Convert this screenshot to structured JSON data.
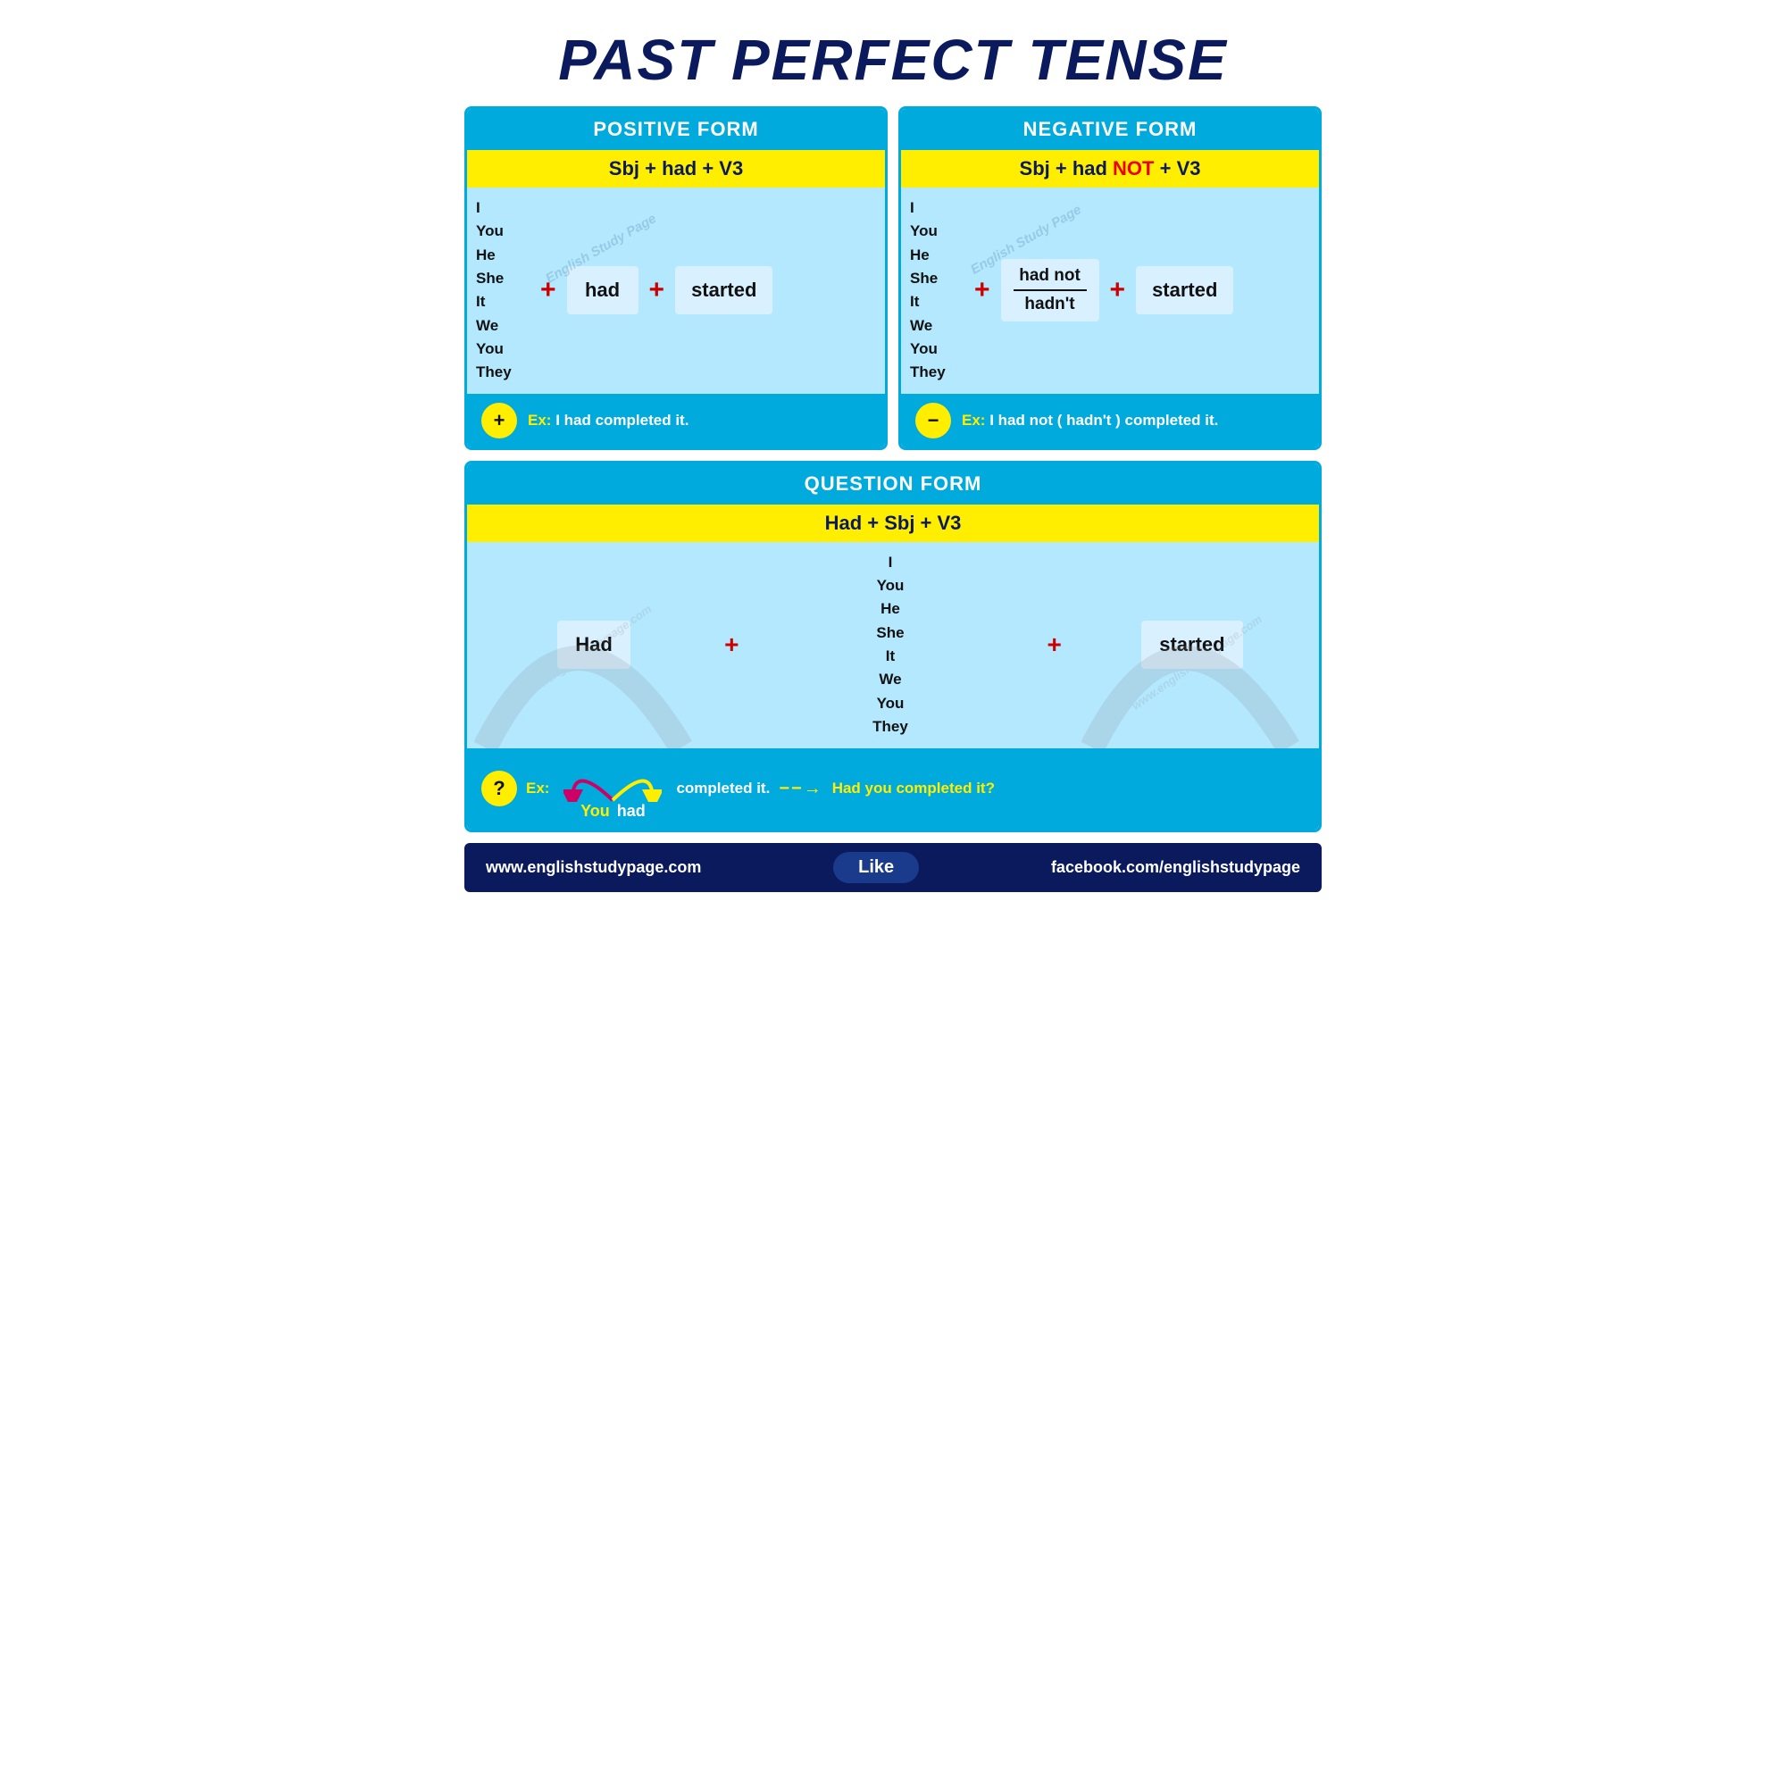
{
  "title": "PAST PERFECT TENSE",
  "positive": {
    "header": "POSITIVE FORM",
    "formula": "Sbj + had + V3",
    "pronouns": "I\nYou\nHe\nShe\nIt\nWe\nYou\nThey",
    "verb": "had",
    "v3": "started",
    "example_label": "Ex:",
    "example_text": "I had completed it.",
    "badge": "+"
  },
  "negative": {
    "header": "NEGATIVE FORM",
    "formula_prefix": "Sbj + had ",
    "formula_not": "NOT",
    "formula_suffix": " + V3",
    "pronouns": "I\nYou\nHe\nShe\nIt\nWe\nYou\nThey",
    "verb_full": "had not",
    "verb_short": "hadn't",
    "v3": "started",
    "example_label": "Ex:",
    "example_text": "I had not ( hadn't ) completed it.",
    "badge": "−"
  },
  "question": {
    "header": "QUESTION FORM",
    "formula": "Had +  Sbj + V3",
    "had": "Had",
    "pronouns": "I\nYou\nHe\nShe\nIt\nWe\nYou\nThey",
    "v3": "started",
    "example_label": "Ex:",
    "you": "You",
    "had_word": "had",
    "completed": "completed it.",
    "arrow_text": "Had you completed it?",
    "badge": "?"
  },
  "watermark": "English Study Page",
  "footer": {
    "left": "www.englishstudypage.com",
    "like": "Like",
    "right": "facebook.com/englishstudypage"
  }
}
